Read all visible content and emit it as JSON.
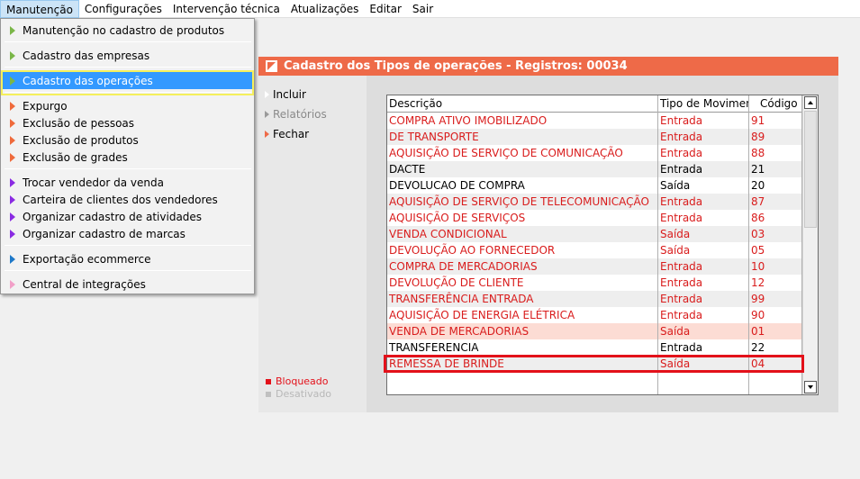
{
  "menubar": [
    "Manutenção",
    "Configurações",
    "Intervenção técnica",
    "Atualizações",
    "Editar",
    "Sair"
  ],
  "dropdown": {
    "items": [
      {
        "label": "Manutenção no cadastro de produtos",
        "color": "#7ab648"
      },
      {
        "label": "Cadastro das empresas",
        "color": "#7ab648"
      },
      {
        "label": "Cadastro das operações",
        "color": "#7ab648",
        "selected": true
      },
      {
        "label": "Expurgo",
        "color": "#ef6a3b"
      },
      {
        "label": "Exclusão de pessoas",
        "color": "#ef6a3b"
      },
      {
        "label": "Exclusão de produtos",
        "color": "#ef6a3b"
      },
      {
        "label": "Exclusão de grades",
        "color": "#ef6a3b"
      },
      {
        "label": "Trocar vendedor da venda",
        "color": "#8a2be2"
      },
      {
        "label": "Carteira de clientes dos vendedores",
        "color": "#8a2be2"
      },
      {
        "label": "Organizar cadastro de atividades",
        "color": "#8a2be2"
      },
      {
        "label": "Organizar cadastro de marcas",
        "color": "#8a2be2"
      },
      {
        "label": "Exportação ecommerce",
        "color": "#1e78c8"
      },
      {
        "label": "Central de integrações",
        "color": "#f2a0c8"
      }
    ]
  },
  "window": {
    "title": "Cadastro dos Tipos de operações - Registros: 00034",
    "title_color": "#ee6a48"
  },
  "actions": {
    "incluir": "Incluir",
    "relatorios": "Relatórios",
    "fechar": "Fechar"
  },
  "legend": {
    "bloqueado": "Bloqueado",
    "desativado": "Desativado",
    "bloqueado_color": "#e3111a",
    "desativado_color": "#c0c0c0"
  },
  "grid": {
    "columns": [
      "Descrição",
      "Tipo de Movimento",
      "Código"
    ],
    "rows": [
      {
        "desc": "COMPRA ATIVO IMOBILIZADO",
        "tipo": "Entrada",
        "codigo": "91",
        "red": true
      },
      {
        "desc": " DE TRANSPORTE",
        "tipo": "Entrada",
        "codigo": "89",
        "red": true
      },
      {
        "desc": "AQUISIÇÃO DE SERVIÇO DE COMUNICAÇÃO",
        "tipo": "Entrada",
        "codigo": "88",
        "red": true
      },
      {
        "desc": "DACTE",
        "tipo": "Entrada",
        "codigo": "21",
        "red": false
      },
      {
        "desc": "DEVOLUCAO DE COMPRA",
        "tipo": "Saída",
        "codigo": "20",
        "red": false
      },
      {
        "desc": "AQUISIÇÃO DE SERVIÇO DE TELECOMUNICAÇÃO",
        "tipo": "Entrada",
        "codigo": "87",
        "red": true
      },
      {
        "desc": "AQUISIÇÃO DE SERVIÇOS",
        "tipo": "Entrada",
        "codigo": "86",
        "red": true
      },
      {
        "desc": "VENDA CONDICIONAL",
        "tipo": "Saída",
        "codigo": "03",
        "red": true
      },
      {
        "desc": "DEVOLUÇÃO AO FORNECEDOR",
        "tipo": "Saída",
        "codigo": "05",
        "red": true
      },
      {
        "desc": "COMPRA DE MERCADORIAS",
        "tipo": "Entrada",
        "codigo": "10",
        "red": true
      },
      {
        "desc": "DEVOLUÇÃO DE CLIENTE",
        "tipo": "Entrada",
        "codigo": "12",
        "red": true
      },
      {
        "desc": "TRANSFERÊNCIA ENTRADA",
        "tipo": "Entrada",
        "codigo": "99",
        "red": true
      },
      {
        "desc": "AQUISIÇÃO DE ENERGIA ELÉTRICA",
        "tipo": "Entrada",
        "codigo": "90",
        "red": true
      },
      {
        "desc": "VENDA DE MERCADORIAS",
        "tipo": "Saída",
        "codigo": "01",
        "red": true,
        "highlight": true
      },
      {
        "desc": "TRANSFERENCIA",
        "tipo": "Entrada",
        "codigo": "22",
        "red": false
      },
      {
        "desc": "REMESSA DE BRINDE",
        "tipo": "Saída",
        "codigo": "04",
        "red": true
      }
    ]
  }
}
